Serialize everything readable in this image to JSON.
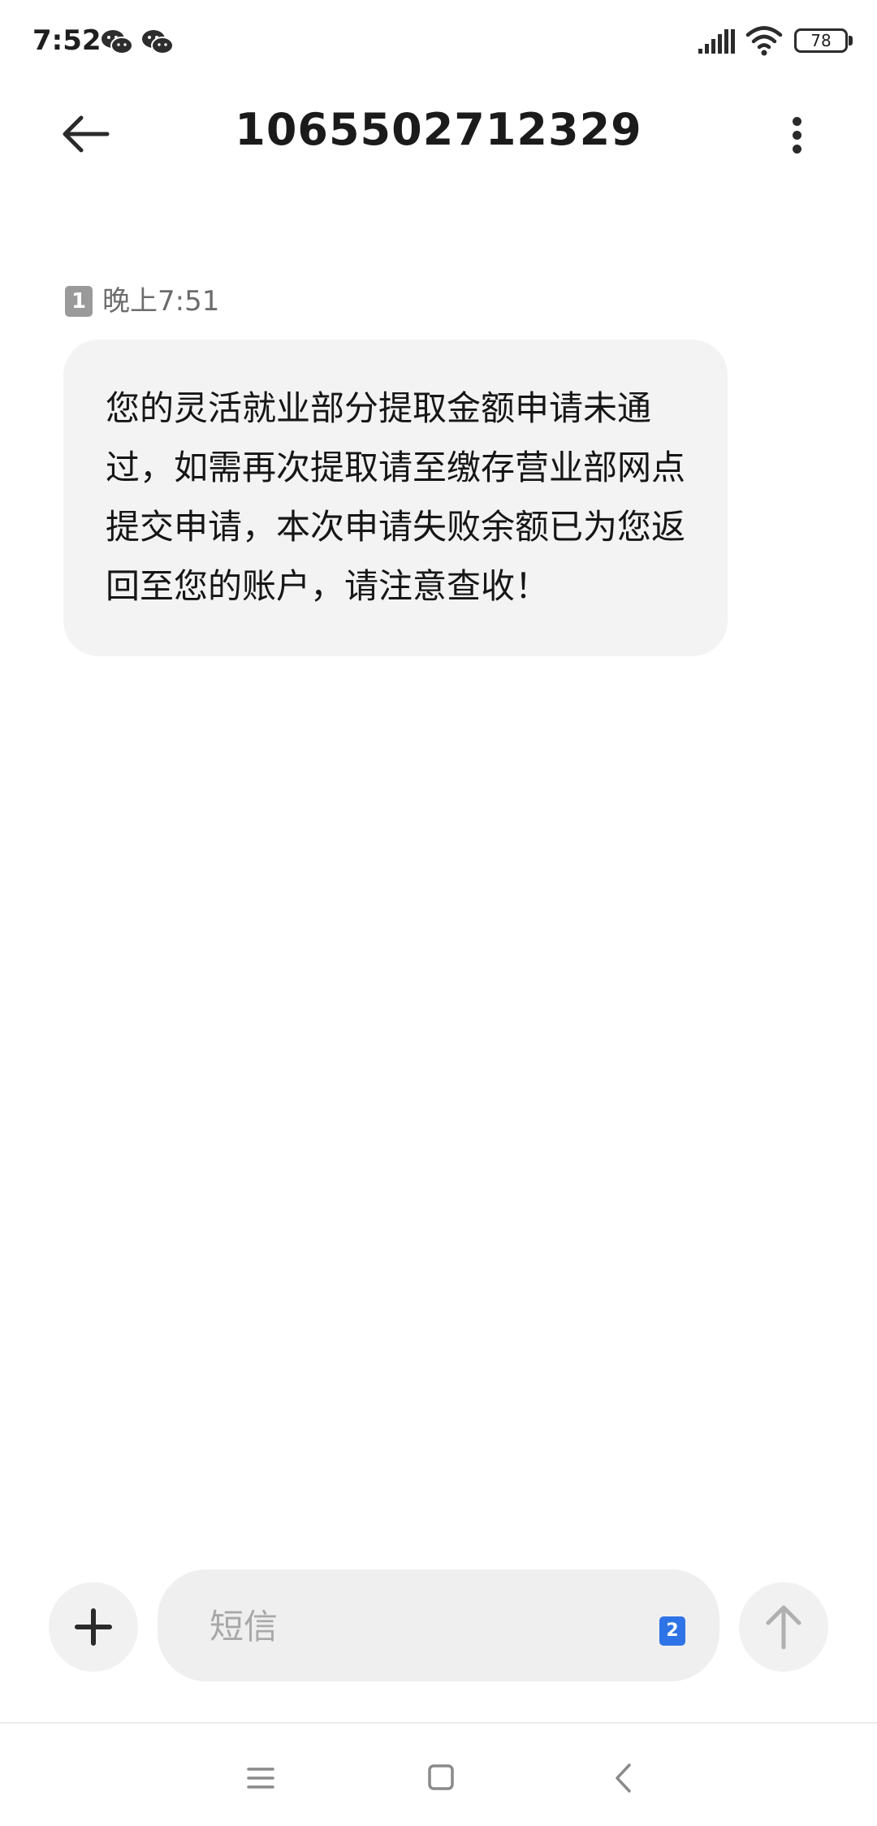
{
  "status_bar": {
    "time": "7:52",
    "notification_icons": [
      "wechat-icon",
      "wechat-icon"
    ],
    "battery": "78"
  },
  "header": {
    "title": "1065502712329"
  },
  "message": {
    "sim_slot": "1",
    "time": "晚上7:51",
    "text": "您的灵活就业部分提取金额申请未通过，如需再次提取请至缴存营业部网点提交申请，本次申请失败余额已为您返回至您的账户，请注意查收！"
  },
  "compose": {
    "placeholder": "短信",
    "sim_slot": "2"
  },
  "colors": {
    "bubble": "#f3f3f3",
    "sim_select": "#2f74e6",
    "placeholder": "#a8a8a8"
  }
}
